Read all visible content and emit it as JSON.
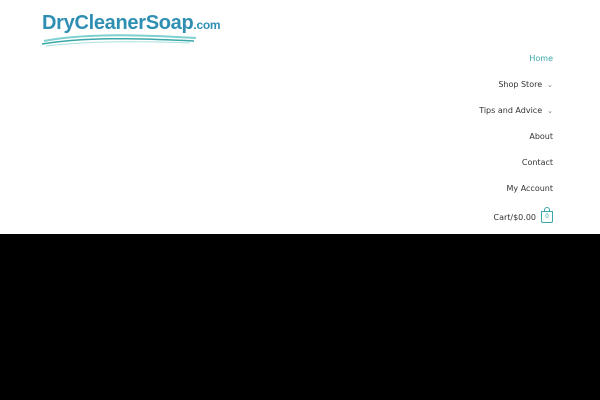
{
  "colors": {
    "accent": "#3aa7a9",
    "logo_blue": "#2f8fb3",
    "text": "#333333",
    "band": "#000000"
  },
  "logo": {
    "name": "DryCleanerSoap",
    "tld": ".com"
  },
  "nav": {
    "items": [
      {
        "label": "Home",
        "active": true,
        "dropdown": false
      },
      {
        "label": "Shop Store",
        "active": false,
        "dropdown": true
      },
      {
        "label": "Tips and Advice",
        "active": false,
        "dropdown": true
      },
      {
        "label": "About",
        "active": false,
        "dropdown": false
      },
      {
        "label": "Contact",
        "active": false,
        "dropdown": false
      },
      {
        "label": "My Account",
        "active": false,
        "dropdown": false
      }
    ],
    "dropdown_icon": "chevron-down-icon",
    "cart": {
      "label": "Cart/$0.00",
      "count": "0",
      "icon": "shopping-bag-icon"
    }
  }
}
